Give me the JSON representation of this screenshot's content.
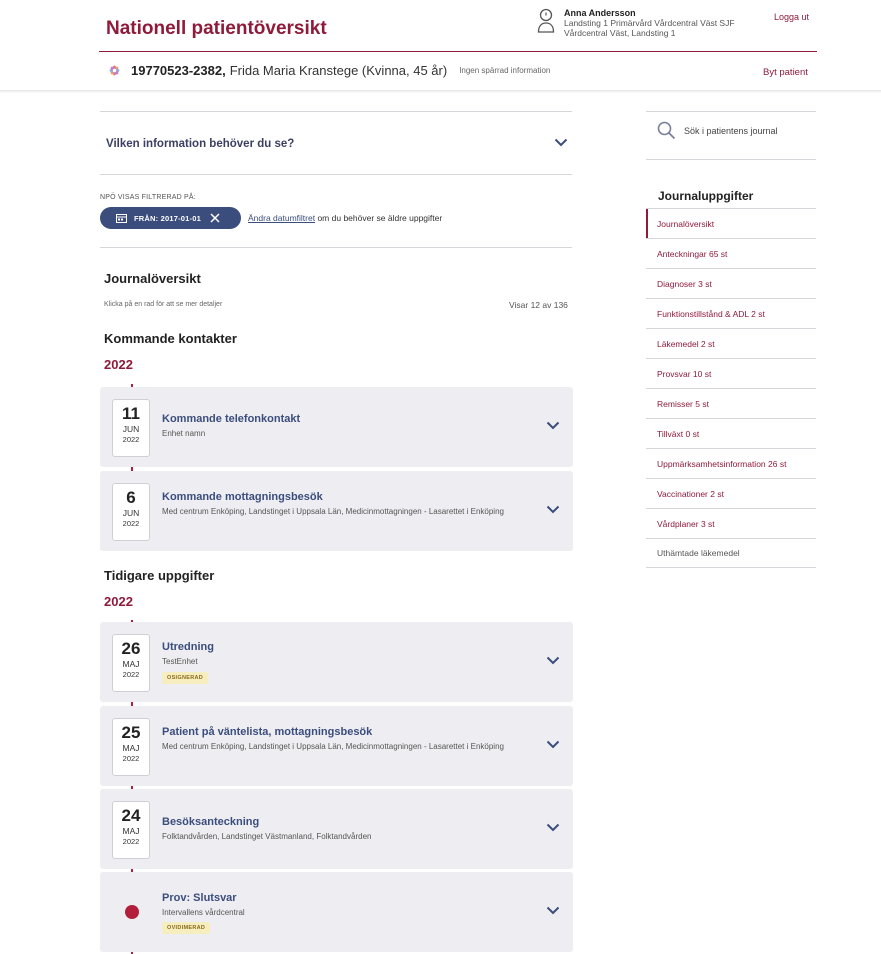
{
  "header": {
    "title": "Nationell patientöversikt",
    "user": {
      "name": "Anna Andersson",
      "line1": "Landsting 1 Primärvård Vårdcentral Väst SJF",
      "line2": "Vårdcentral Väst, Landsting 1"
    },
    "logout_label": "Logga ut",
    "patient": {
      "id": "19770523-2382,",
      "name": "Frida Maria Kranstege (Kvinna, 45 år)",
      "restricted": "Ingen spärrad information"
    },
    "switch_patient_label": "Byt patient"
  },
  "main": {
    "info_question": "Vilken information behöver du se?",
    "filter": {
      "label": "NPÖ VISAS FILTRERAD PÅ:",
      "pill_text": "FRÅN: 2017-01-01",
      "hint_link": "Ändra datumfiltret",
      "hint_rest": " om du behöver se äldre uppgifter"
    },
    "overview_title": "Journalöversikt",
    "overview_sub": "Klicka på en rad för att se mer detaljer",
    "showing": "Visar 12 av 136",
    "upcoming": {
      "title": "Kommande kontakter",
      "year": "2022",
      "items": [
        {
          "day": "11",
          "month": "JUN",
          "year": "2022",
          "title": "Kommande telefonkontakt",
          "sub": "Enhet namn"
        },
        {
          "day": "6",
          "month": "JUN",
          "year": "2022",
          "title": "Kommande mottagningsbesök",
          "sub": "Med centrum Enköping, Landstinget i Uppsala Län, Medicinmottagningen - Lasarettet i Enköping"
        }
      ]
    },
    "previous": {
      "title": "Tidigare uppgifter",
      "year": "2022",
      "items": [
        {
          "day": "26",
          "month": "MAJ",
          "year": "2022",
          "title": "Utredning",
          "sub": "TestEnhet",
          "badge": "OSIGNERAD"
        },
        {
          "day": "25",
          "month": "MAJ",
          "year": "2022",
          "title": "Patient på väntelista, mottagningsbesök",
          "sub": "Med centrum Enköping, Landstinget i Uppsala Län, Medicinmottagningen - Lasarettet i Enköping"
        },
        {
          "day": "24",
          "month": "MAJ",
          "year": "2022",
          "title": "Besöksanteckning",
          "sub": "Folktandvården, Landstinget Västmanland, Folktandvården"
        },
        {
          "title": "Prov: Slutsvar",
          "sub": "Intervallens vårdcentral",
          "badge": "OVIDIMERAD"
        }
      ]
    }
  },
  "sidebar": {
    "search_label": "Sök i patientens journal",
    "heading": "Journaluppgifter",
    "items": [
      {
        "label": "Journalöversikt"
      },
      {
        "label": "Anteckningar  65 st"
      },
      {
        "label": "Diagnoser  3 st"
      },
      {
        "label": "Funktionstillstånd & ADL  2 st"
      },
      {
        "label": "Läkemedel  2 st"
      },
      {
        "label": "Provsvar  10 st"
      },
      {
        "label": "Remisser  5 st"
      },
      {
        "label": "Tillväxt  0 st"
      },
      {
        "label": "Uppmärksamhetsinformation  26 st"
      },
      {
        "label": "Vaccinationer  2 st"
      },
      {
        "label": "Vårdplaner  3 st"
      },
      {
        "label": "Uthämtade läkemedel"
      }
    ]
  },
  "colors": {
    "brand": "#8f1b3b",
    "accent": "#3b4d7d",
    "timeline": "#b21e3c",
    "card_bg": "#eeeef2"
  }
}
